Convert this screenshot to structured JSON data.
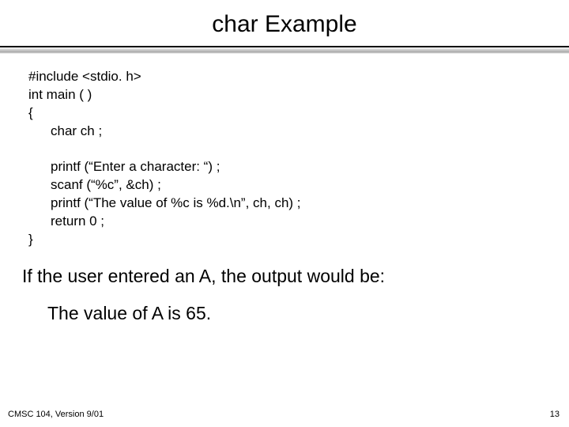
{
  "title": "char Example",
  "code": {
    "l1": "#include <stdio. h>",
    "l2": "int main ( )",
    "l3": "{",
    "l4": "char ch ;",
    "l5": "printf (“Enter a character: “) ;",
    "l6": "scanf (“%c”, &ch) ;",
    "l7": "printf (“The value of %c is %d.\\n”, ch, ch) ;",
    "l8": "return 0 ;",
    "l9": "}"
  },
  "explain": "If the user entered an A, the output would be:",
  "output": "The value of A is 65.",
  "footer": {
    "left": "CMSC 104, Version 9/01",
    "right": "13"
  }
}
